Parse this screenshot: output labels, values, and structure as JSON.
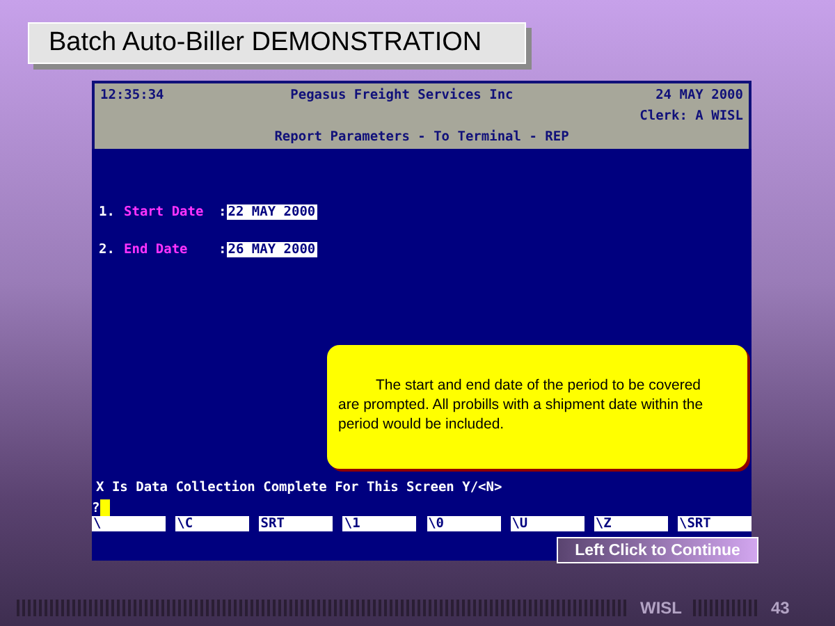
{
  "slide_title": "Batch Auto-Biller DEMONSTRATION",
  "terminal": {
    "time": "12:35:34",
    "company": "Pegasus Freight Services Inc",
    "date": "24 MAY 2000",
    "clerk": "Clerk: A WISL",
    "screen_title": "Report Parameters - To Terminal - REP",
    "fields": [
      {
        "number": "1.",
        "label": "Start Date",
        "separator": ":",
        "value": "22 MAY 2000"
      },
      {
        "number": "2.",
        "label": "End Date",
        "separator": ":",
        "value": "26 MAY 2000"
      }
    ],
    "prompt": "X Is Data Collection Complete For This Screen Y/<N>",
    "input_prompt": "?",
    "function_keys": [
      "\\",
      "\\C",
      "SRT",
      "\\1",
      "\\0",
      "\\U",
      "\\Z",
      "\\SRT"
    ]
  },
  "callout": "The start and end date of the period to be covered are prompted. All probills with a shipment date within the period would be included.",
  "continue_button": "Left Click to Continue",
  "footer": {
    "brand": "WISL",
    "page": "43"
  }
}
